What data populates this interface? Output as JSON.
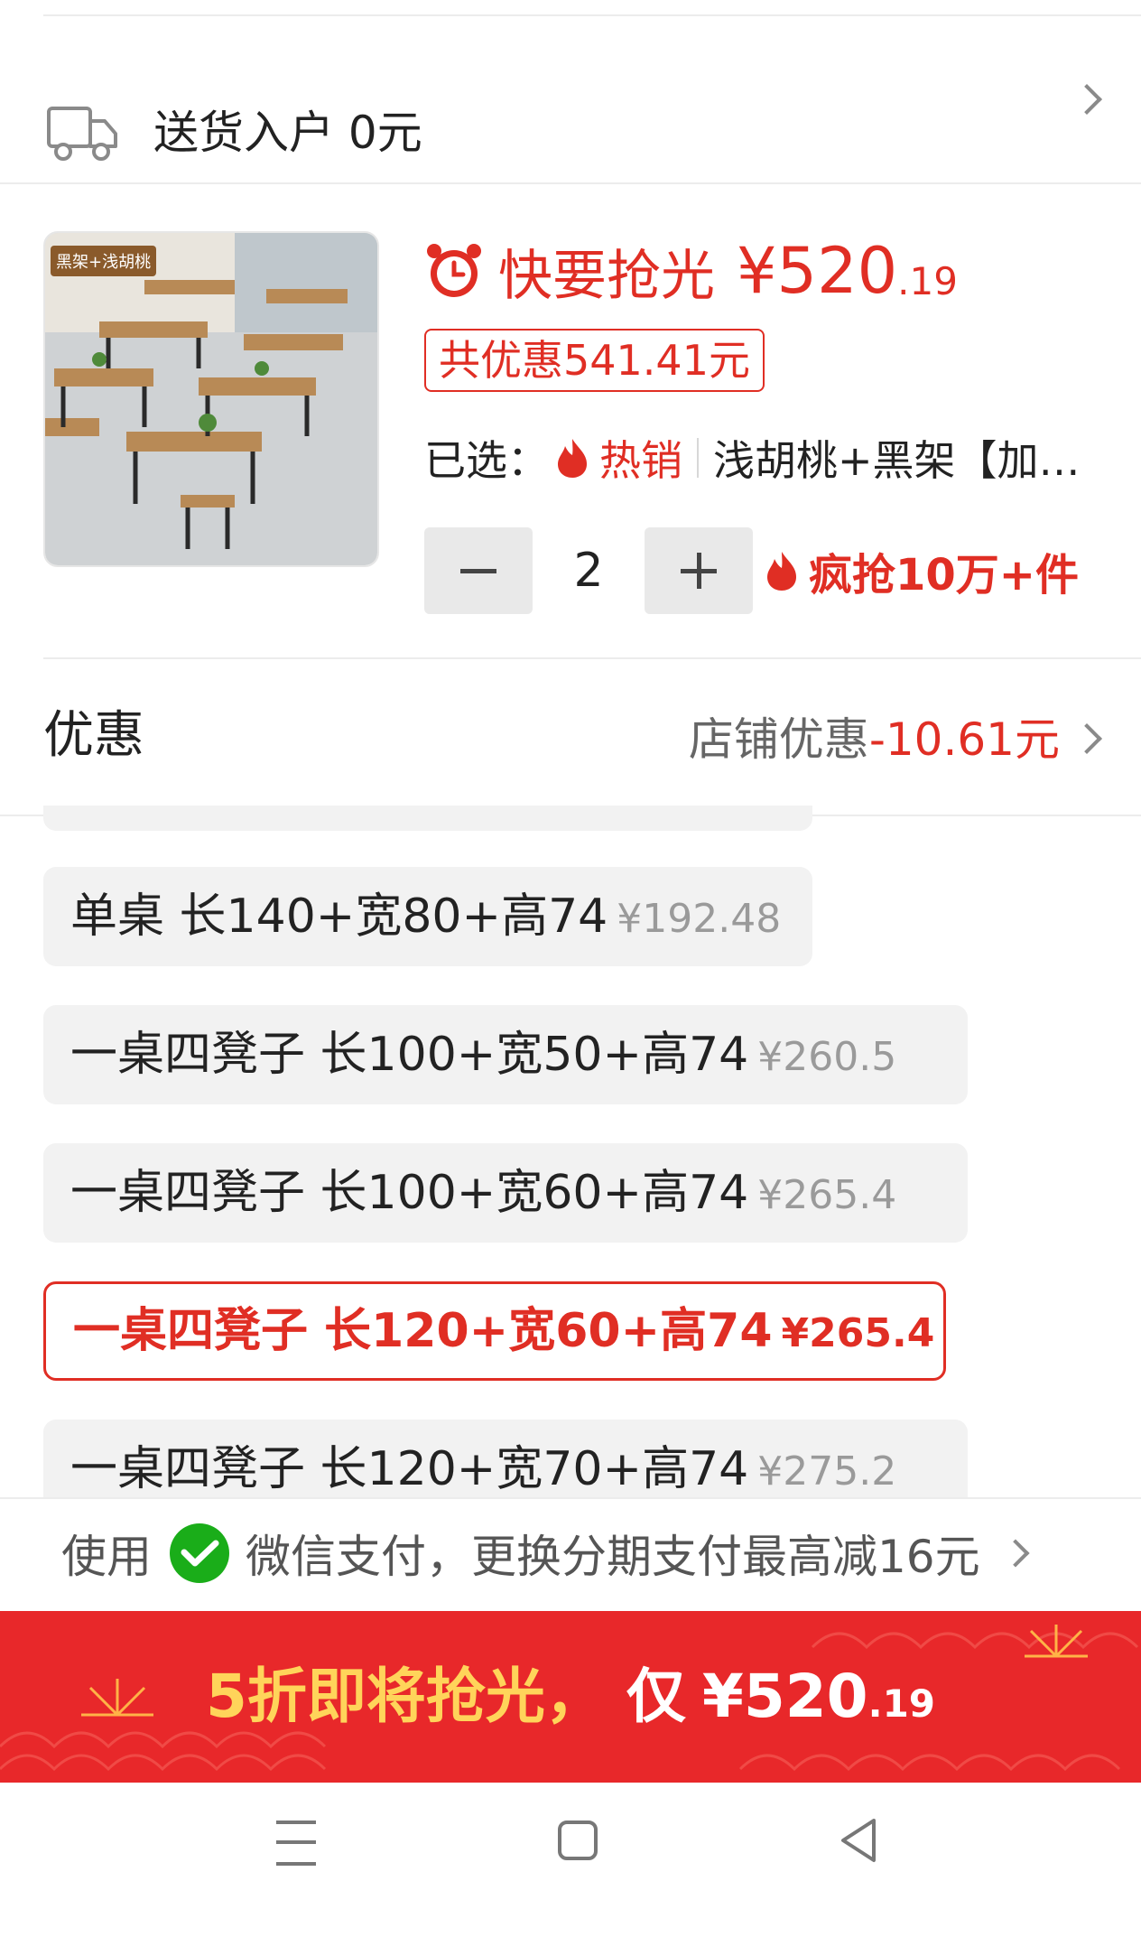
{
  "delivery": {
    "icon": "truck-icon",
    "text": "送货入户 0元"
  },
  "product": {
    "image_tag": "黑架+浅胡桃",
    "urgency_label": "快要抢光",
    "price_main": "¥520",
    "price_decimal": ".19",
    "total_discount": "共优惠541.41元",
    "selected_prefix": "已选：",
    "hot_label": "热销",
    "selected_value": "浅胡桃+黑架【加…",
    "quantity": "2",
    "sales_badge": "疯抢10万+件"
  },
  "discount": {
    "title": "优惠",
    "shop_label": "店铺优惠",
    "amount": "-10.61元"
  },
  "options": [
    {
      "label": "单桌 长140+宽80+高74",
      "price": "¥192.48",
      "selected": false
    },
    {
      "label": "一桌四凳子 长100+宽50+高74",
      "price": "¥260.5",
      "selected": false
    },
    {
      "label": "一桌四凳子 长100+宽60+高74",
      "price": "¥265.4",
      "selected": false
    },
    {
      "label": "一桌四凳子 长120+宽60+高74",
      "price": "¥265.4",
      "selected": true
    },
    {
      "label": "一桌四凳子 长120+宽70+高74",
      "price": "¥275.2",
      "selected": false
    }
  ],
  "payment": {
    "prefix": "使用",
    "method": "微信支付，更换分期支付最高减16元"
  },
  "banner": {
    "text": "5折即将抢光，",
    "only": "仅",
    "price_main": "¥520",
    "price_decimal": ".19"
  },
  "colors": {
    "accent": "#e02e24",
    "banner_bg": "#e8282a",
    "banner_highlight": "#ffd45a",
    "wechat_green": "#1aad19"
  }
}
